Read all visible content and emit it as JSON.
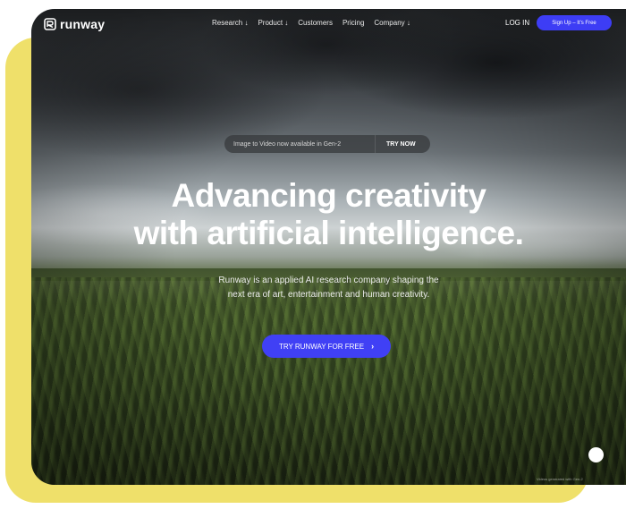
{
  "brand": {
    "name": "runway",
    "accent_color": "#3d3df5",
    "backdrop_color": "#efe06a"
  },
  "nav": {
    "links": [
      "Research ↓",
      "Product ↓",
      "Customers",
      "Pricing",
      "Company ↓"
    ],
    "login_label": "LOG IN",
    "signup_label": "Sign Up – It's Free"
  },
  "announcement": {
    "text": "Image to Video now available in Gen-2",
    "cta": "TRY NOW"
  },
  "hero": {
    "headline_line1": "Advancing creativity",
    "headline_line2": "with artificial intelligence.",
    "subhead_line1": "Runway is an applied AI research company shaping the",
    "subhead_line2": "next era of art, entertainment and human creativity.",
    "cta_label": "TRY RUNWAY FOR FREE",
    "cta_icon": "chevron-right-icon"
  },
  "footer": {
    "credit": "Videos generated with Gen-2"
  }
}
